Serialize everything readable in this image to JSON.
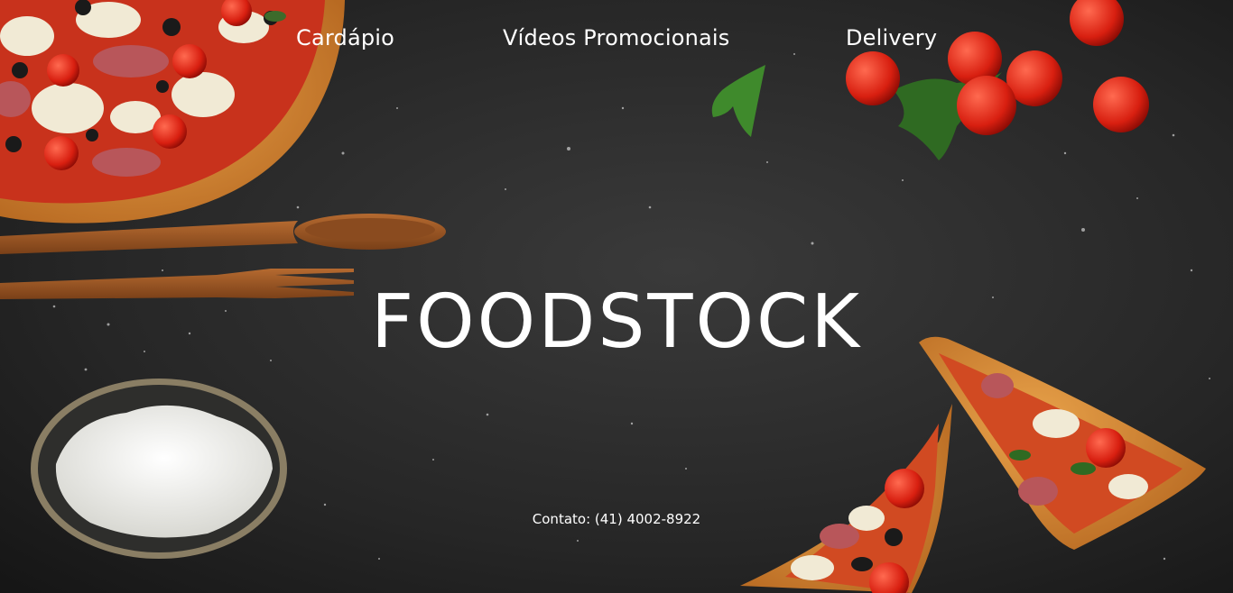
{
  "nav": {
    "items": [
      {
        "label": "Cardápio"
      },
      {
        "label": "Vídeos Promocionais"
      },
      {
        "label": "Delivery"
      }
    ]
  },
  "hero": {
    "brand": "FOODSTOCK"
  },
  "footer": {
    "contact": "Contato: (41) 4002-8922"
  },
  "background": {
    "description_icons": [
      "pizza-image",
      "wooden-spoon-image",
      "wooden-fork-image",
      "flour-bowl-image",
      "cherry-tomatoes-image",
      "parsley-leaf-image",
      "pizza-slices-image"
    ],
    "base_color": "#232323"
  }
}
